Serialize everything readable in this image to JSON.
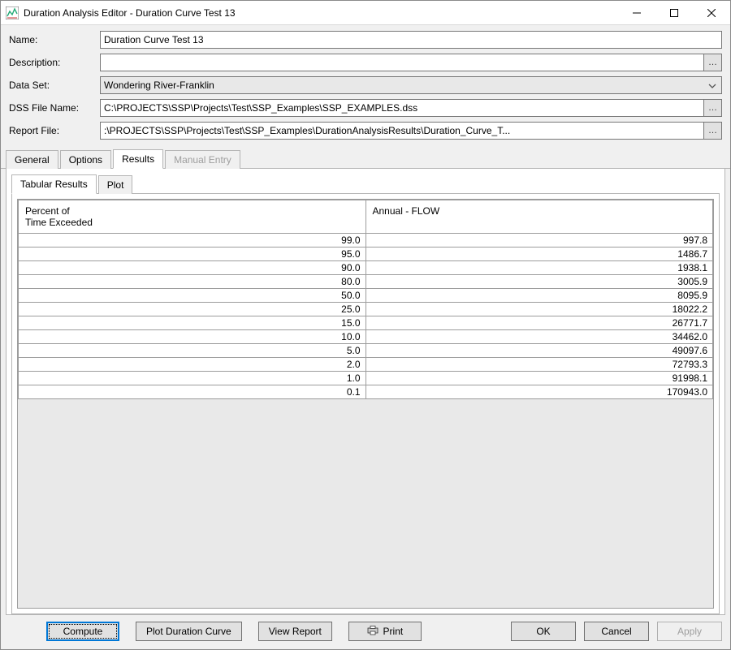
{
  "window": {
    "title": "Duration Analysis Editor - Duration Curve Test 13"
  },
  "form": {
    "name_label": "Name:",
    "name_value": "Duration Curve Test 13",
    "description_label": "Description:",
    "description_value": "",
    "dataset_label": "Data Set:",
    "dataset_value": "Wondering River-Franklin",
    "dssfile_label": "DSS File Name:",
    "dssfile_value": "C:\\PROJECTS\\SSP\\Projects\\Test\\SSP_Examples\\SSP_EXAMPLES.dss",
    "reportfile_label": "Report File:",
    "reportfile_value": ":\\PROJECTS\\SSP\\Projects\\Test\\SSP_Examples\\DurationAnalysisResults\\Duration_Curve_T..."
  },
  "tabs": {
    "general": "General",
    "options": "Options",
    "results": "Results",
    "manual": "Manual Entry"
  },
  "subtabs": {
    "tabular": "Tabular Results",
    "plot": "Plot"
  },
  "table": {
    "col1": "Percent of\nTime Exceeded",
    "col2": "Annual - FLOW",
    "rows": [
      {
        "p": "99.0",
        "v": "997.8"
      },
      {
        "p": "95.0",
        "v": "1486.7"
      },
      {
        "p": "90.0",
        "v": "1938.1"
      },
      {
        "p": "80.0",
        "v": "3005.9"
      },
      {
        "p": "50.0",
        "v": "8095.9"
      },
      {
        "p": "25.0",
        "v": "18022.2"
      },
      {
        "p": "15.0",
        "v": "26771.7"
      },
      {
        "p": "10.0",
        "v": "34462.0"
      },
      {
        "p": "5.0",
        "v": "49097.6"
      },
      {
        "p": "2.0",
        "v": "72793.3"
      },
      {
        "p": "1.0",
        "v": "91998.1"
      },
      {
        "p": "0.1",
        "v": "170943.0"
      }
    ]
  },
  "buttons": {
    "compute": "Compute",
    "plot_curve": "Plot Duration Curve",
    "view_report": "View Report",
    "print": "Print",
    "ok": "OK",
    "cancel": "Cancel",
    "apply": "Apply"
  },
  "icons": {
    "ellipsis": "…"
  }
}
